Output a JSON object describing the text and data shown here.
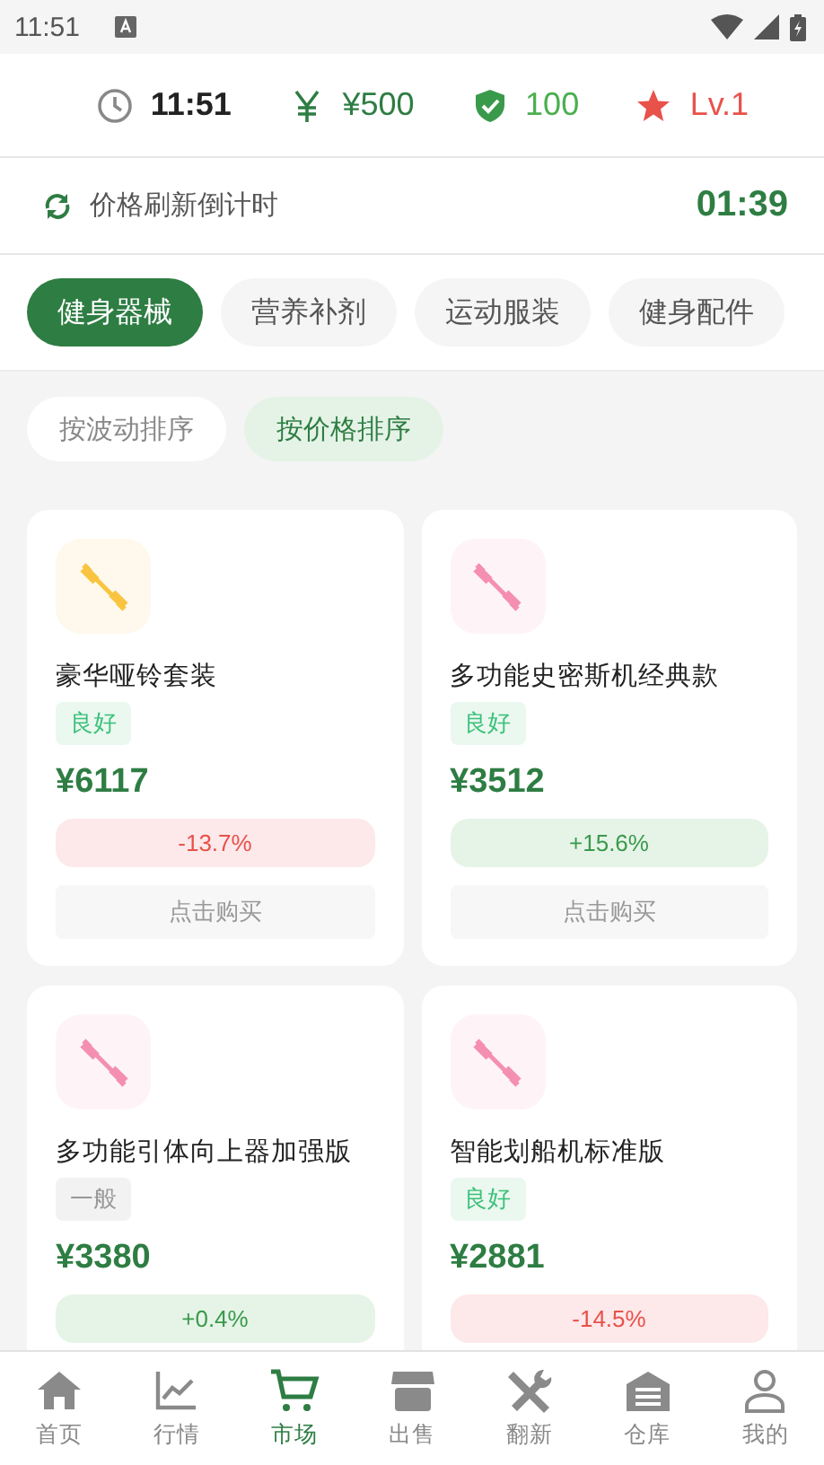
{
  "status_bar": {
    "time": "11:51"
  },
  "stats": {
    "time": "11:51",
    "money": "¥500",
    "health": "100",
    "level": "Lv.1"
  },
  "refresh": {
    "label": "价格刷新倒计时",
    "countdown": "01:39"
  },
  "categories": [
    {
      "label": "健身器械",
      "selected": true
    },
    {
      "label": "营养补剂",
      "selected": false
    },
    {
      "label": "运动服装",
      "selected": false
    },
    {
      "label": "健身配件",
      "selected": false
    }
  ],
  "sort_options": [
    {
      "label": "按波动排序",
      "selected": false
    },
    {
      "label": "按价格排序",
      "selected": true
    }
  ],
  "products": [
    {
      "name": "豪华哑铃套装",
      "color": "#f9c440",
      "condition": "良好",
      "condition_good": true,
      "price": "¥6117",
      "change": "-13.7%",
      "rising": false,
      "buy_label": "点击购买"
    },
    {
      "name": "多功能史密斯机经典款",
      "color": "#f48fb1",
      "condition": "良好",
      "condition_good": true,
      "price": "¥3512",
      "change": "+15.6%",
      "rising": true,
      "buy_label": "点击购买"
    },
    {
      "name": "多功能引体向上器加强版",
      "color": "#f48fb1",
      "condition": "一般",
      "condition_good": false,
      "price": "¥3380",
      "change": "+0.4%",
      "rising": true
    },
    {
      "name": "智能划船机标准版",
      "color": "#f48fb1",
      "condition": "良好",
      "condition_good": true,
      "price": "¥2881",
      "change": "-14.5%",
      "rising": false
    }
  ],
  "nav": [
    {
      "label": "首页",
      "selected": false
    },
    {
      "label": "行情",
      "selected": false
    },
    {
      "label": "市场",
      "selected": true
    },
    {
      "label": "出售",
      "selected": false
    },
    {
      "label": "翻新",
      "selected": false
    },
    {
      "label": "仓库",
      "selected": false
    },
    {
      "label": "我的",
      "selected": false
    }
  ]
}
